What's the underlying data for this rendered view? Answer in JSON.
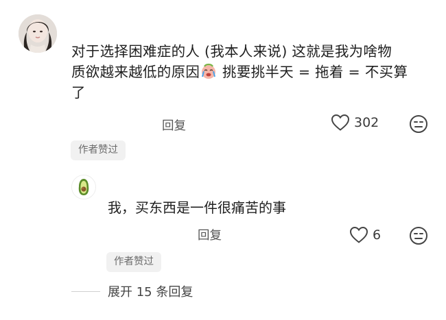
{
  "comment": {
    "text_line1": "对于选择困难症的人 (我本人来说)  这就是我为啥物",
    "text_line2a": "质欲越来越低的原因",
    "inline_emoji": "crying-face",
    "text_line2b": " 挑要挑半天 = 拖着 = 不买算",
    "text_line3": "了",
    "reply_label": "回复",
    "likes": "302",
    "author_liked_badge": "作者赞过",
    "icons": [
      "heart-icon",
      "meh-face-icon"
    ]
  },
  "reply": {
    "avatar_icon": "avocado-icon",
    "text": "我，买东西是一件很痛苦的事",
    "reply_label": "回复",
    "likes": "6",
    "author_liked_badge": "作者赞过"
  },
  "expand": {
    "label": "展开 15 条回复"
  },
  "colors": {
    "text": "#1f1f1f",
    "secondary_text": "#555555",
    "badge_bg": "#f1f1f1",
    "badge_text": "#6b6b6b",
    "avocado_green": "#5b8c2a"
  }
}
